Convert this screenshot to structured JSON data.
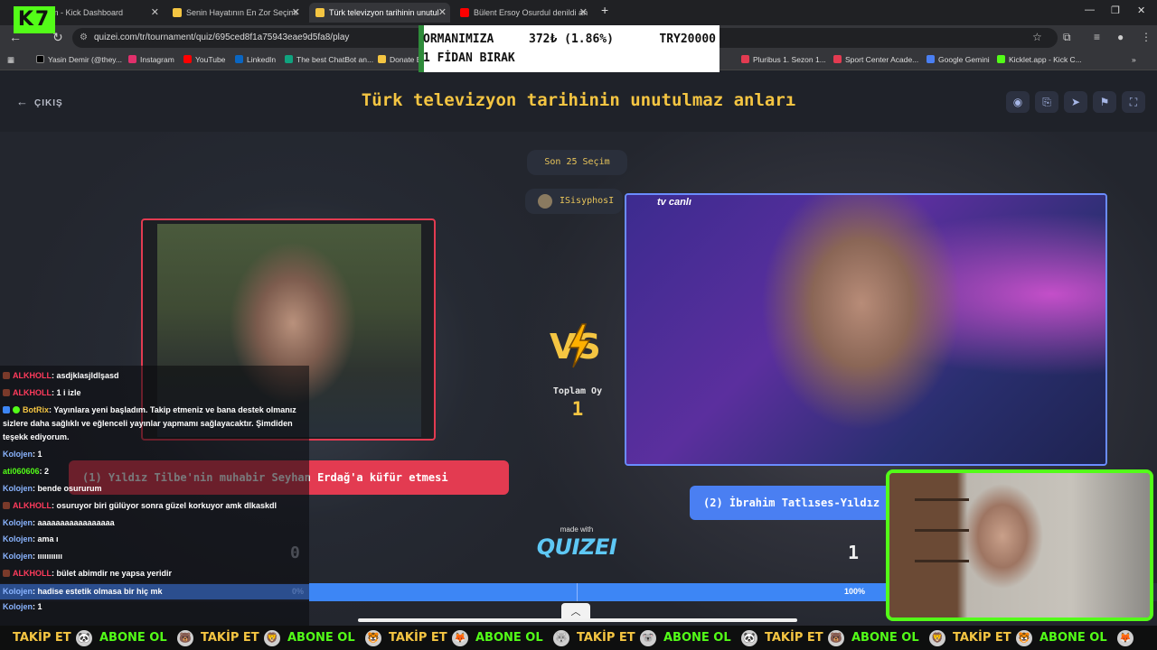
{
  "browser": {
    "tabs": [
      {
        "label": "am - Kick Dashboard",
        "color": "#53fc18"
      },
      {
        "label": "Senin Hayatının En Zor Seçimi",
        "color": "#f4c542"
      },
      {
        "label": "Türk televizyon tarihinin unutul",
        "color": "#f4c542"
      },
      {
        "label": "Bülent Ersoy Osurdul denildi an",
        "color": "#ff0000"
      }
    ],
    "url": "quizei.com/tr/tournament/quiz/695ced8f1a75943eae9d5fa8/play",
    "bookmarks": [
      {
        "label": "Yasin Demir (@they...",
        "color": "#000000"
      },
      {
        "label": "Instagram",
        "color": "#e1306c"
      },
      {
        "label": "YouTube",
        "color": "#ff0000"
      },
      {
        "label": "LinkedIn",
        "color": "#0a66c2"
      },
      {
        "label": "The best ChatBot an...",
        "color": "#10a37f"
      },
      {
        "label": "Donate B",
        "color": "#f4c542"
      },
      {
        "label": "Pluribus 1. Sezon 1...",
        "color": "#e33b51"
      },
      {
        "label": "Sport Center Acade...",
        "color": "#e33b51"
      },
      {
        "label": "Google Gemini",
        "color": "#4a7ff2"
      },
      {
        "label": "Kicklet.app - Kick C...",
        "color": "#53fc18"
      }
    ]
  },
  "stream": {
    "logo": "K7",
    "donation": {
      "line1": "ORMANIMIZA",
      "amount": "372₺ (1.86%)",
      "goal": "TRY20000",
      "line2": "1 FİDAN BIRAK"
    },
    "ticker": [
      "TAKİP ET",
      "ABONE OL",
      "TAKİP ET",
      "ABONE OL",
      "TAKİP ET",
      "ABONE OL",
      "TAKİP ET",
      "ABONE OL",
      "TAKİP ET",
      "ABONE OL",
      "TAKİP ET",
      "ABONE OL",
      "TAKİP ET",
      "ABONE OL"
    ]
  },
  "quiz": {
    "exit_label": "ÇIKIŞ",
    "title": "Türk televizyon tarihinin unutulmaz anları",
    "last_choices": "Son 25 Seçim",
    "player": "ISisyphosI",
    "tv_logo": "tv canlı",
    "vs": "VS",
    "total_votes_label": "Toplam Oy",
    "total_votes": "1",
    "option1": "(1) Yıldız Tilbe'nin muhabir Seyhan Erdağ'a küfür etmesi",
    "option2": "(2) İbrahim Tatlıses-Yıldız",
    "made_with": "made with",
    "brand": "QUIZEI",
    "count1": "0",
    "count2": "1",
    "pct1": "0%",
    "pct2": "100%",
    "progress_right_fraction": 1.0
  },
  "chat": [
    {
      "user": "ALKHOLL",
      "msg": ": asdjklasjldlşasd",
      "color": "#ff3b5c"
    },
    {
      "user": "ALKHOLL",
      "msg": ": 1 i izle",
      "color": "#ff3b5c"
    },
    {
      "user": "BotRix",
      "msg": ": Yayınlara yeni başladım. Takip etmeniz ve bana destek olmanız sizlere daha sağlıklı ve eğlenceli yayınlar yapmamı sağlayacaktır. Şimdiden teşekk ediyorum.",
      "color": "#f4c542"
    },
    {
      "user": "Kolojen",
      "msg": ": 1",
      "color": "#8ab4ff"
    },
    {
      "user": "ati060606",
      "msg": ": 2",
      "color": "#53fc18"
    },
    {
      "user": "Kolojen",
      "msg": ": bende osururum",
      "color": "#8ab4ff"
    },
    {
      "user": "ALKHOLL",
      "msg": ": osuruyor biri gülüyor sonra güzel korkuyor amk dlkaskdl",
      "color": "#ff3b5c"
    },
    {
      "user": "Kolojen",
      "msg": ": aaaaaaaaaaaaaaaaa",
      "color": "#8ab4ff"
    },
    {
      "user": "Kolojen",
      "msg": ": ama ı",
      "color": "#8ab4ff"
    },
    {
      "user": "Kolojen",
      "msg": ": ııııııııııı",
      "color": "#8ab4ff"
    },
    {
      "user": "ALKHOLL",
      "msg": ": bület abimdir ne yapsa yeridir",
      "color": "#ff3b5c"
    },
    {
      "user": "Kolojen",
      "msg": ": hadise estetik olmasa bir hiç mk",
      "color": "#8ab4ff"
    },
    {
      "user": "Kolojen",
      "msg": ": 1",
      "color": "#8ab4ff"
    }
  ]
}
